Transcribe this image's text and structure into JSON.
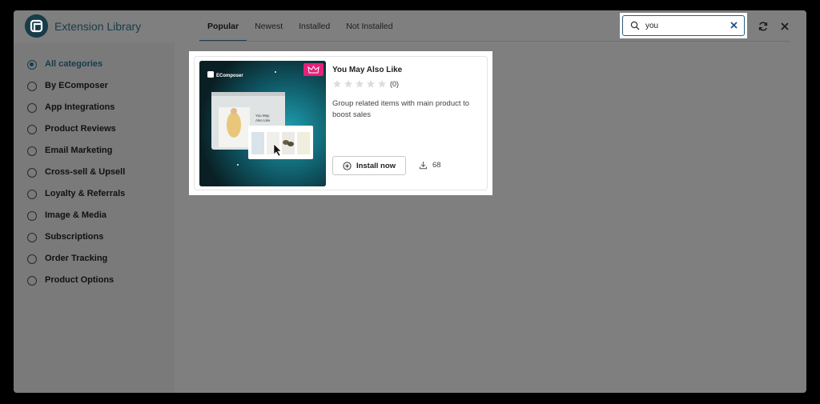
{
  "app": {
    "title": "Extension Library",
    "logo_icon": "ecomposer-logo-icon"
  },
  "tabs": [
    {
      "label": "Popular",
      "active": true
    },
    {
      "label": "Newest",
      "active": false
    },
    {
      "label": "Installed",
      "active": false
    },
    {
      "label": "Not Installed",
      "active": false
    }
  ],
  "search": {
    "value": "you",
    "placeholder": "",
    "icon": "search-icon",
    "clear_icon": "close-icon"
  },
  "header_actions": {
    "refresh_icon": "refresh-icon",
    "close_icon": "close-icon"
  },
  "categories": [
    {
      "label": "All categories",
      "selected": true
    },
    {
      "label": "By EComposer",
      "selected": false
    },
    {
      "label": "App Integrations",
      "selected": false
    },
    {
      "label": "Product Reviews",
      "selected": false
    },
    {
      "label": "Email Marketing",
      "selected": false
    },
    {
      "label": "Cross-sell & Upsell",
      "selected": false
    },
    {
      "label": "Loyalty & Referrals",
      "selected": false
    },
    {
      "label": "Image & Media",
      "selected": false
    },
    {
      "label": "Subscriptions",
      "selected": false
    },
    {
      "label": "Order Tracking",
      "selected": false
    },
    {
      "label": "Product Options",
      "selected": false
    }
  ],
  "extension": {
    "title": "You May Also Like",
    "rating_stars": 0,
    "rating_max": 5,
    "rating_count": "(0)",
    "description": "Group related items with main product to boost sales",
    "install_label": "Install now",
    "downloads": "68",
    "thumbnail": {
      "brand": "EComposer",
      "mock_heading_1": "You May",
      "mock_heading_2": "Also Like",
      "premium_icon": "crown-icon"
    }
  },
  "colors": {
    "brand": "#173c4a",
    "overlay": "#7f7f7f",
    "premium": "#e5217a"
  }
}
